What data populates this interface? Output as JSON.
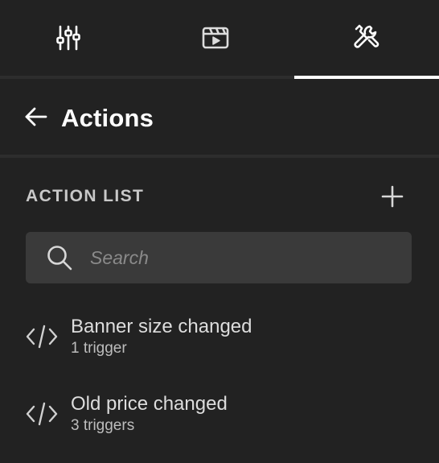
{
  "tabs": [
    {
      "icon": "sliders-icon",
      "active": false
    },
    {
      "icon": "clapperboard-icon",
      "active": false
    },
    {
      "icon": "tools-icon",
      "active": true
    }
  ],
  "header": {
    "title": "Actions",
    "back_icon": "arrow-left-icon"
  },
  "action_list": {
    "section_title": "ACTION LIST",
    "add_icon": "plus-icon",
    "search": {
      "placeholder": "Search",
      "value": ""
    },
    "items": [
      {
        "name": "Banner size changed",
        "triggers": "1 trigger",
        "icon": "code-icon"
      },
      {
        "name": "Old price changed",
        "triggers": "3 triggers",
        "icon": "code-icon"
      }
    ]
  },
  "colors": {
    "background": "#222222",
    "divider": "#2d2d2d",
    "search_bg": "#3a3a3a",
    "active_underline": "#ffffff"
  }
}
